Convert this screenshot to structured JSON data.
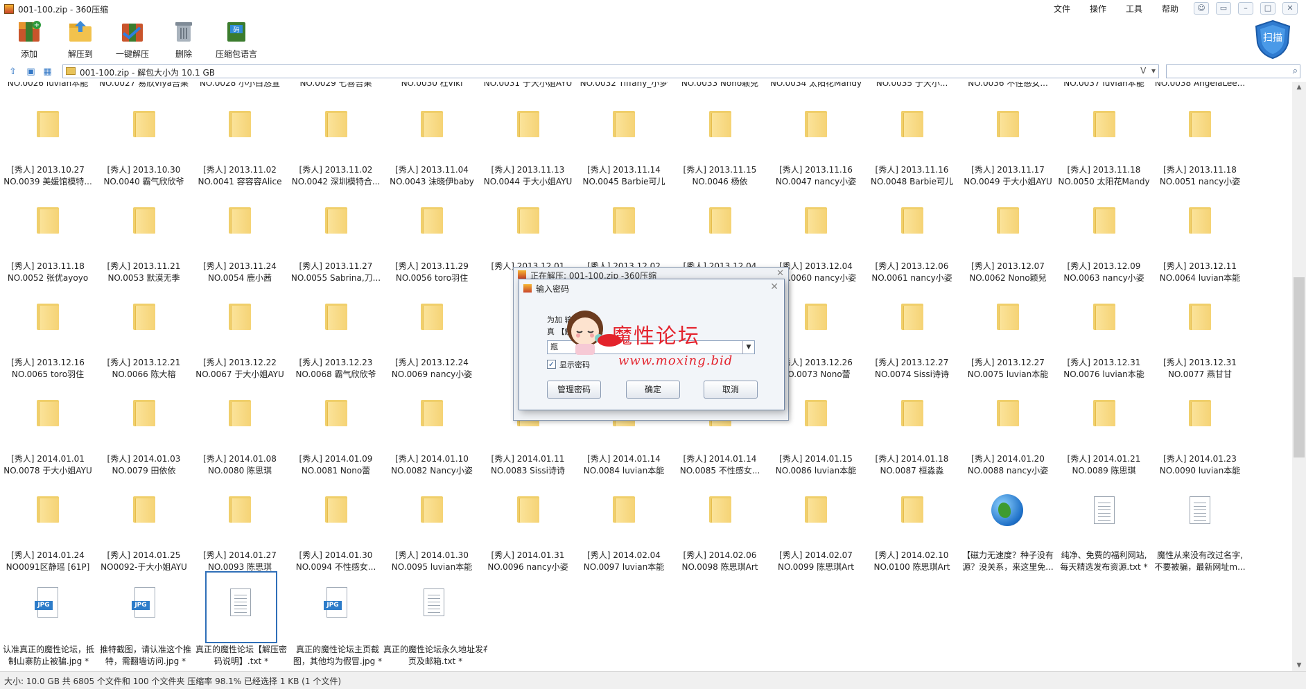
{
  "window": {
    "title": "001-100.zip - 360压缩"
  },
  "menu": [
    "文件",
    "操作",
    "工具",
    "帮助"
  ],
  "toolbar": {
    "add": "添加",
    "extract_to": "解压到",
    "one_click": "一键解压",
    "delete": "删除",
    "language": "压缩包语言",
    "scan": "扫描"
  },
  "address": {
    "path": "001-100.zip - 解包大小为 10.1 GB",
    "dropdown": "V"
  },
  "top_row": [
    "NO.0026 luvian本能",
    "NO.0027 易欣viya吾果",
    "NO.0028 小小白悠宣",
    "NO.0029 七喜吾果",
    "NO.0030 杜viki",
    "NO.0031 于大小姐AYU",
    "NO.0032 Tiffany_小梦",
    "NO.0033 Nono颖兒",
    "NO.0034 太阳花Mandy",
    "NO.0035 于大小...",
    "NO.0036 不性感女...",
    "NO.0037 luvian本能",
    "NO.0038 AngelaLee..."
  ],
  "rows": [
    [
      [
        "[秀人] 2013.10.27",
        "NO.0039 美媛馆模特..."
      ],
      [
        "[秀人] 2013.10.30",
        "NO.0040 霸气欣欣爷"
      ],
      [
        "[秀人] 2013.11.02",
        "NO.0041 容容容Alice"
      ],
      [
        "[秀人] 2013.11.02",
        "NO.0042 深圳模特合..."
      ],
      [
        "[秀人] 2013.11.04",
        "NO.0043 沫晓伊baby"
      ],
      [
        "[秀人] 2013.11.13",
        "NO.0044 于大小姐AYU"
      ],
      [
        "[秀人] 2013.11.14",
        "NO.0045 Barbie可儿"
      ],
      [
        "[秀人] 2013.11.15",
        "NO.0046 杨依"
      ],
      [
        "[秀人] 2013.11.16",
        "NO.0047 nancy小姿"
      ],
      [
        "[秀人] 2013.11.16",
        "NO.0048 Barbie可儿"
      ],
      [
        "[秀人] 2013.11.17",
        "NO.0049 于大小姐AYU"
      ],
      [
        "[秀人] 2013.11.18",
        "NO.0050 太阳花Mandy"
      ],
      [
        "[秀人] 2013.11.18",
        "NO.0051 nancy小姿"
      ]
    ],
    [
      [
        "[秀人] 2013.11.18",
        "NO.0052 张优ayoyo"
      ],
      [
        "[秀人] 2013.11.21",
        "NO.0053 默漠无季"
      ],
      [
        "[秀人] 2013.11.24",
        "NO.0054 鹿小茜"
      ],
      [
        "[秀人] 2013.11.27",
        "NO.0055 Sabrina,刀..."
      ],
      [
        "[秀人] 2013.11.29",
        "NO.0056 toro羽住"
      ],
      [
        "[秀人] 2013.12.01",
        "NO.0..."
      ],
      [
        "[秀人] 2013.12.02",
        ""
      ],
      [
        "[秀人] 2013.12.04",
        ""
      ],
      [
        "[秀人] 2013.12.04",
        "NO.0060 nancy小姿"
      ],
      [
        "[秀人] 2013.12.06",
        "NO.0061 nancy小姿"
      ],
      [
        "[秀人] 2013.12.07",
        "NO.0062 Nono颖兒"
      ],
      [
        "[秀人] 2013.12.09",
        "NO.0063 nancy小姿"
      ],
      [
        "[秀人] 2013.12.11",
        "NO.0064 luvian本能"
      ]
    ],
    [
      [
        "[秀人] 2013.12.16",
        "NO.0065 toro羽住"
      ],
      [
        "[秀人] 2013.12.21",
        "NO.0066 陈大榕"
      ],
      [
        "[秀人] 2013.12.22",
        "NO.0067 于大小姐AYU"
      ],
      [
        "[秀人] 2013.12.23",
        "NO.0068 霸气欣欣爷"
      ],
      [
        "[秀人] 2013.12.24",
        "NO.0069 nancy小姿"
      ],
      [
        "[秀人]",
        "NO.0..."
      ],
      [
        "",
        ""
      ],
      [
        "",
        ""
      ],
      [
        "[秀人] 2013.12.26",
        "NO.0073 Nono蕾"
      ],
      [
        "[秀人] 2013.12.27",
        "NO.0074 Sissi诗诗"
      ],
      [
        "[秀人] 2013.12.27",
        "NO.0075 luvian本能"
      ],
      [
        "[秀人] 2013.12.31",
        "NO.0076 luvian本能"
      ],
      [
        "[秀人] 2013.12.31",
        "NO.0077 燕甘甘"
      ]
    ],
    [
      [
        "[秀人] 2014.01.01",
        "NO.0078 于大小姐AYU"
      ],
      [
        "[秀人] 2014.01.03",
        "NO.0079 田依依"
      ],
      [
        "[秀人] 2014.01.08",
        "NO.0080  陈思琪"
      ],
      [
        "[秀人] 2014.01.09",
        "NO.0081 Nono蕾"
      ],
      [
        "[秀人] 2014.01.10",
        "NO.0082 Nancy小姿"
      ],
      [
        "[秀人] 2014.01.11",
        "NO.0083 Sissi诗诗"
      ],
      [
        "[秀人] 2014.01.14",
        "NO.0084 luvian本能"
      ],
      [
        "[秀人] 2014.01.14",
        "NO.0085 不性感女..."
      ],
      [
        "[秀人] 2014.01.15",
        "NO.0086 luvian本能"
      ],
      [
        "[秀人] 2014.01.18",
        "NO.0087 桓淼淼"
      ],
      [
        "[秀人] 2014.01.20",
        "NO.0088 nancy小姿"
      ],
      [
        "[秀人] 2014.01.21",
        "NO.0089 陈思琪"
      ],
      [
        "[秀人] 2014.01.23",
        "NO.0090 luvian本能"
      ]
    ],
    [
      [
        "[秀人] 2014.01.24",
        "NO0091区静瑶 [61P]"
      ],
      [
        "[秀人] 2014.01.25",
        "NO0092-于大小姐AYU"
      ],
      [
        "[秀人] 2014.01.27",
        "NO.0093 陈思琪"
      ],
      [
        "[秀人] 2014.01.30",
        "NO.0094 不性感女..."
      ],
      [
        "[秀人] 2014.01.30",
        "NO.0095 luvian本能"
      ],
      [
        "[秀人] 2014.01.31",
        "NO.0096 nancy小姿"
      ],
      [
        "[秀人] 2014.02.04",
        "NO.0097  luvian本能"
      ],
      [
        "[秀人] 2014.02.06",
        "NO.0098 陈思琪Art"
      ],
      [
        "[秀人] 2014.02.07",
        "NO.0099 陈思琪Art"
      ],
      [
        "[秀人] 2014.02.10",
        "NO.0100 陈思琪Art"
      ],
      [
        "【磁力无速度？种子没有",
        "源？没关系，来这里免..."
      ],
      [
        "纯净、免费的福利网站,",
        "每天精选发布资源.txt *"
      ],
      [
        "魔性从来没有改过名字,",
        "不要被骗，最新网址m..."
      ]
    ]
  ],
  "last_row": [
    [
      "认准真正的魔性论坛，抵",
      "制山寨防止被骗.jpg *"
    ],
    [
      "推特截图，请认准这个推",
      "特，需翻墙访问.jpg *"
    ],
    [
      "真正的魔性论坛【解压密",
      "码说明】.txt *"
    ],
    [
      "真正的魔性论坛主页截",
      "图，其他均为假冒.jpg *"
    ],
    [
      "真正的魔性论坛永久地址发布",
      "页及邮箱.txt *"
    ]
  ],
  "jpg_tag": "JPG",
  "status": "大小: 10.0 GB 共 6805 个文件和 100 个文件夹 压缩率 98.1% 已经选择 1 KB (1 个文件)",
  "dialog_back": {
    "title": "正在解压: 001-100.zip -360压缩"
  },
  "dialog": {
    "title": "输入密码",
    "prompt": "为加      输入密码:",
    "file": "真           【解       明】.txt",
    "combo_value": "瓶",
    "checkbox_label": "显示密码",
    "btn_manage": "管理密码",
    "btn_ok": "确定",
    "btn_cancel": "取消"
  },
  "watermark": {
    "text": "魔性论坛",
    "url": "www.moxing.bid"
  },
  "colors": {
    "folder": "#f5d375",
    "selection": "#2f6fb8",
    "watermark": "#e4232d"
  }
}
